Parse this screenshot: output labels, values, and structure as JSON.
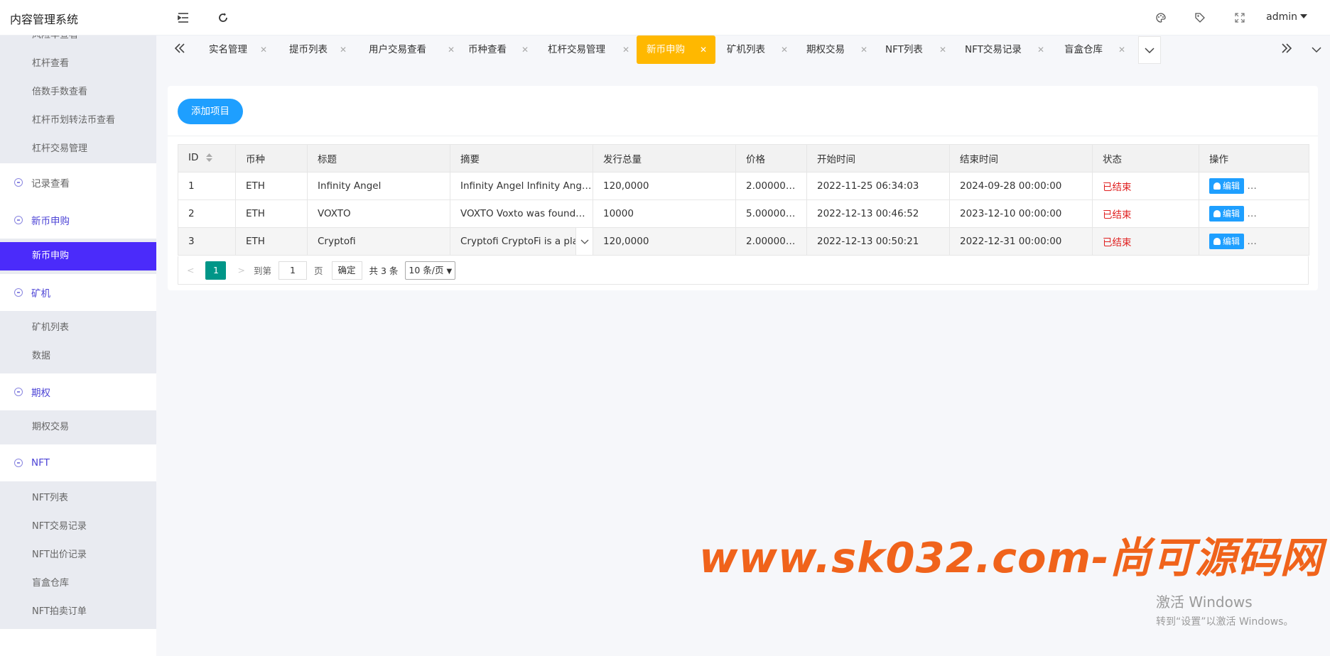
{
  "app": {
    "title": "内容管理系统",
    "user": "admin"
  },
  "toolbar": {
    "icons": [
      "menu-fold-icon",
      "refresh-icon",
      "palette-icon",
      "tag-icon",
      "fullscreen-icon"
    ]
  },
  "sidebar": {
    "partial_item": "风险率查看",
    "group0_items": [
      "杠杆查看",
      "倍数手数查看",
      "杠杆币划转法币查看",
      "杠杆交易管理"
    ],
    "groups": [
      {
        "label": "记录查看"
      },
      {
        "label": "新币申购",
        "items": [
          "新币申购"
        ]
      },
      {
        "label": "矿机",
        "items": [
          "矿机列表",
          "数据"
        ]
      },
      {
        "label": "期权",
        "items": [
          "期权交易"
        ]
      },
      {
        "label": "NFT",
        "items": [
          "NFT列表",
          "NFT交易记录",
          "NFT出价记录",
          "盲盒仓库",
          "NFT拍卖订单"
        ]
      }
    ]
  },
  "tabs": [
    "实名管理",
    "提币列表",
    "用户交易查看",
    "币种查看",
    "杠杆交易管理",
    "新币申购",
    "矿机列表",
    "期权交易",
    "NFT列表",
    "NFT交易记录",
    "盲盒仓库"
  ],
  "active_tab": "新币申购",
  "main": {
    "add_button": "添加项目",
    "columns": [
      "ID",
      "币种",
      "标题",
      "摘要",
      "发行总量",
      "价格",
      "开始时间",
      "结束时间",
      "状态",
      "操作"
    ],
    "rows": [
      {
        "id": "1",
        "coin": "ETH",
        "title": "Infinity Angel",
        "summary": "Infinity Angel Infinity Ang…",
        "total": "120,0000",
        "price": "2.00000…",
        "start": "2022-11-25 06:34:03",
        "end": "2024-09-28 00:00:00",
        "status": "已结束",
        "action": "编辑",
        "more": "…"
      },
      {
        "id": "2",
        "coin": "ETH",
        "title": "VOXTO",
        "summary": "VOXTO Voxto was found…",
        "total": "10000",
        "price": "5.00000…",
        "start": "2022-12-13 00:46:52",
        "end": "2023-12-10 00:00:00",
        "status": "已结束",
        "action": "编辑",
        "more": "…"
      },
      {
        "id": "3",
        "coin": "ETH",
        "title": "Cryptofi",
        "summary": "Cryptofi CryptoFi is a pla…",
        "total": "120,0000",
        "price": "2.00000…",
        "start": "2022-12-13 00:50:21",
        "end": "2022-12-31 00:00:00",
        "status": "已结束",
        "action": "编辑",
        "more": "…"
      }
    ],
    "pagination": {
      "current": "1",
      "goto_label": "到第",
      "goto_value": "1",
      "page_label": "页",
      "confirm": "确定",
      "total": "共 3 条",
      "page_size": "10 条/页"
    }
  },
  "watermark": "www.sk032.com-尚可源码网",
  "activation": {
    "line1": "激活 Windows",
    "line2": "转到“设置”以激活 Windows。"
  },
  "colors": {
    "primary": "#1e9fff",
    "active_tab": "#ffb800",
    "sidebar_active": "#4b2bfa",
    "status": "#e02020",
    "pager_current": "#009688",
    "watermark": "#f0631b"
  }
}
